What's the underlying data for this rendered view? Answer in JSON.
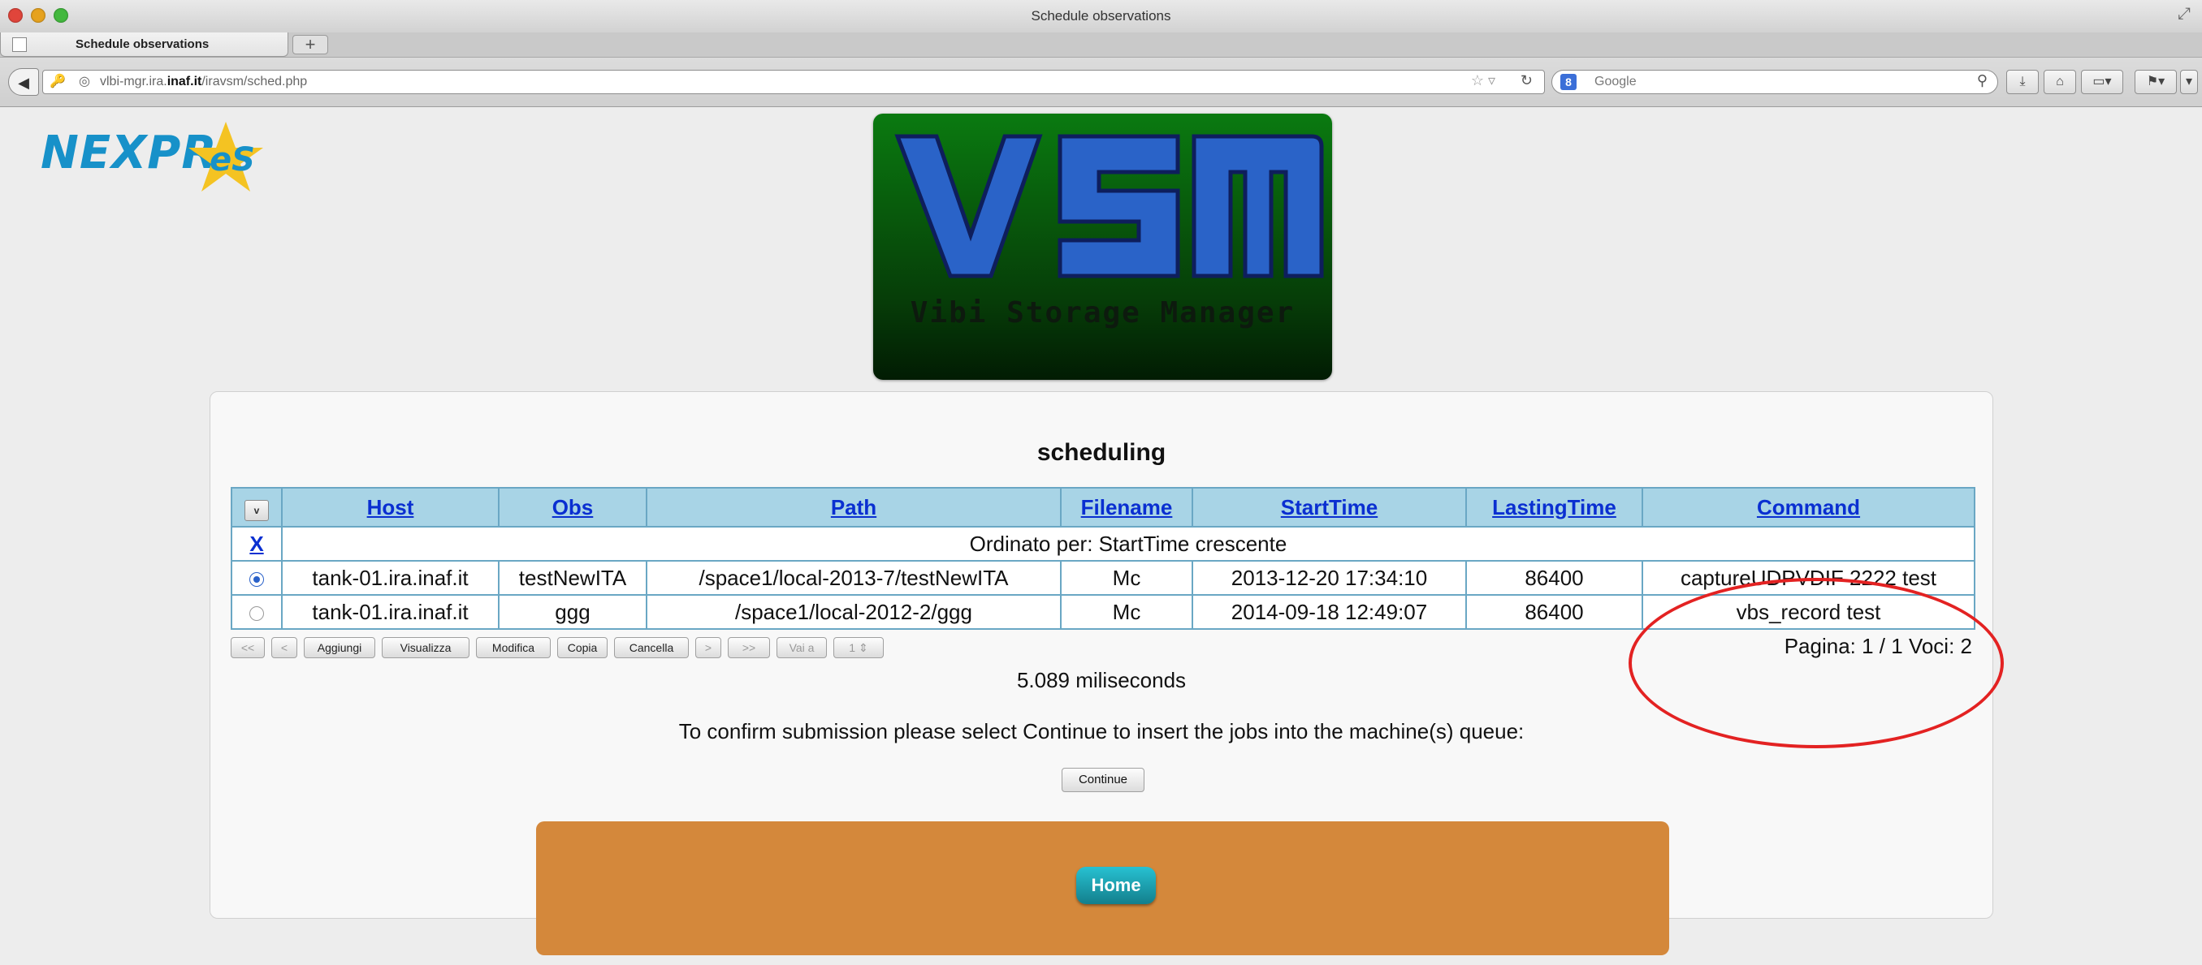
{
  "window": {
    "title": "Schedule observations",
    "tab_label": "Schedule observations",
    "new_tab": "+"
  },
  "navbar": {
    "url_prefix": "vlbi-mgr.ira.",
    "url_domain": "inaf.it",
    "url_path": "/iravsm/sched.php",
    "search_engine": "8",
    "search_placeholder": "Google"
  },
  "logos": {
    "nexpres_text_a": "NEXPR",
    "nexpres_text_b": "eS",
    "vsm_letters": "VSM",
    "vsm_subtitle": "Vibi Storage Manager"
  },
  "panel": {
    "title": "scheduling",
    "select_all_label": "v",
    "columns": [
      "Host",
      "Obs",
      "Path",
      "Filename",
      "StartTime",
      "LastingTime",
      "Command"
    ],
    "clear_sort": "X",
    "sort_info": "Ordinato per: StartTime crescente",
    "rows": [
      {
        "selected": true,
        "host": "tank-01.ira.inaf.it",
        "obs": "testNewITA",
        "path": "/space1/local-2013-7/testNewITA",
        "filename": "Mc",
        "start": "2013-12-20 17:34:10",
        "lasting": "86400",
        "command": "captureUDPVDIF 2222 test"
      },
      {
        "selected": false,
        "host": "tank-01.ira.inaf.it",
        "obs": "ggg",
        "path": "/space1/local-2012-2/ggg",
        "filename": "Mc",
        "start": "2014-09-18 12:49:07",
        "lasting": "86400",
        "command": "vbs_record test"
      }
    ],
    "pager": {
      "first": "<<",
      "prev": "<",
      "add": "Aggiungi",
      "view": "Visualizza",
      "edit": "Modifica",
      "copy": "Copia",
      "delete": "Cancella",
      "next": ">",
      "last": ">>",
      "goto": "Vai a",
      "page_select": "1",
      "info": "Pagina: 1 / 1  Voci: 2"
    },
    "timing": "5.089 miliseconds",
    "confirm": "To confirm submission please select Continue to insert the jobs into the machine(s) queue:",
    "continue_label": "Continue"
  },
  "footer": {
    "home_label": "Home"
  },
  "colors": {
    "header_bg": "#a8d4e6",
    "footer_bg": "#d4883b",
    "banner_green": "#0a7a10",
    "highlight": "#e32222",
    "link": "#0a2fd1"
  }
}
